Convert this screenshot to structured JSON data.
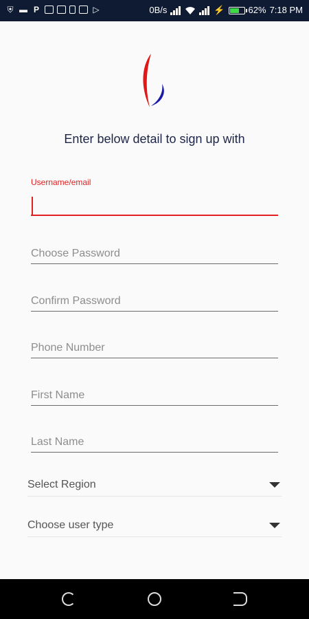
{
  "status_bar": {
    "network_speed": "0B/s",
    "battery_percent": "62%",
    "time": "7:18 PM",
    "battery_level": 0.62,
    "left_icons": [
      "shield-icon",
      "message-icon",
      "parking-icon",
      "image-icon",
      "media-icon",
      "phone-icon",
      "photo-icon",
      "play-icon"
    ]
  },
  "logo": {
    "name": "brand-logo",
    "colors": [
      "#e01818",
      "#1a1aa8"
    ]
  },
  "form": {
    "subtitle": "Enter below detail to sign up with",
    "username": {
      "label": "Username/email",
      "value": ""
    },
    "password": {
      "placeholder": "Choose Password"
    },
    "confirm_password": {
      "placeholder": "Confirm Password"
    },
    "phone": {
      "placeholder": "Phone Number"
    },
    "first_name": {
      "placeholder": "First Name"
    },
    "last_name": {
      "placeholder": "Last Name"
    },
    "region": {
      "label": "Select Region"
    },
    "user_type": {
      "label": "Choose user type"
    }
  },
  "colors": {
    "accent": "#e22020",
    "status_bar": "#0f1b33",
    "text_dark": "#1d2547"
  }
}
